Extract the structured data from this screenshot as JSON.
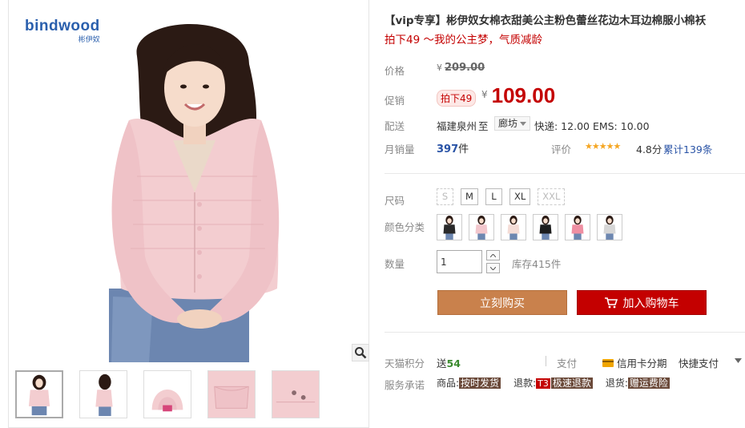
{
  "brand": {
    "logo_text": "bindwood",
    "logo_subtext": "彬伊奴"
  },
  "product": {
    "title": "【vip专享】彬伊奴女棉衣甜美公主粉色蕾丝花边木耳边棉服小棉袄",
    "subtitle": "拍下49 ～我的公主梦，气质减龄"
  },
  "price": {
    "label": "价格",
    "currency": "¥",
    "original": "209.00",
    "promo_label": "促销",
    "promo_tag": "拍下49",
    "promo_price": "109.00"
  },
  "shipping": {
    "label": "配送",
    "from": "福建泉州",
    "to_word": "至",
    "to_city": "廊坊",
    "fee_text": "快递: 12.00 EMS: 10.00"
  },
  "sales": {
    "label": "月销量",
    "count": "397",
    "unit": "件",
    "rating_label": "评价",
    "stars": 5,
    "stars_text": "★★★★★",
    "score": "4.8分",
    "reviews": "累计139条"
  },
  "sizes": {
    "label": "尺码",
    "options": [
      {
        "name": "S",
        "available": false
      },
      {
        "name": "M",
        "available": true
      },
      {
        "name": "L",
        "available": true
      },
      {
        "name": "XL",
        "available": true
      },
      {
        "name": "XXL",
        "available": false
      }
    ]
  },
  "colors": {
    "label": "颜色分类",
    "swatches": [
      "#2a2a2a",
      "#f2c6cc",
      "#f4dcd6",
      "#1d1d1d",
      "#ef8fa2",
      "#d6d6d6"
    ]
  },
  "quantity": {
    "label": "数量",
    "value": "1",
    "stock": "库存415件"
  },
  "actions": {
    "buy_now": "立刻购买",
    "add_to_cart": "加入购物车"
  },
  "tmall": {
    "points_label": "天猫积分",
    "points_prefix": "送",
    "points_value": "54",
    "pay_label": "支付",
    "pay_credit": "信用卡分期",
    "pay_quick": "快捷支付",
    "promise_label": "服务承诺",
    "promises": [
      {
        "key": "商品:",
        "badge": "",
        "value": "按时发货"
      },
      {
        "key": "退款:",
        "badge": "T3",
        "value": "极速退款"
      },
      {
        "key": "退货:",
        "badge": "",
        "value": "赠运费险"
      }
    ]
  },
  "colors_theme": {
    "accent_red": "#c40000",
    "buy_orange": "#c9814c",
    "link_blue": "#2953a6",
    "jacket_pink": "#f3cdd0"
  }
}
